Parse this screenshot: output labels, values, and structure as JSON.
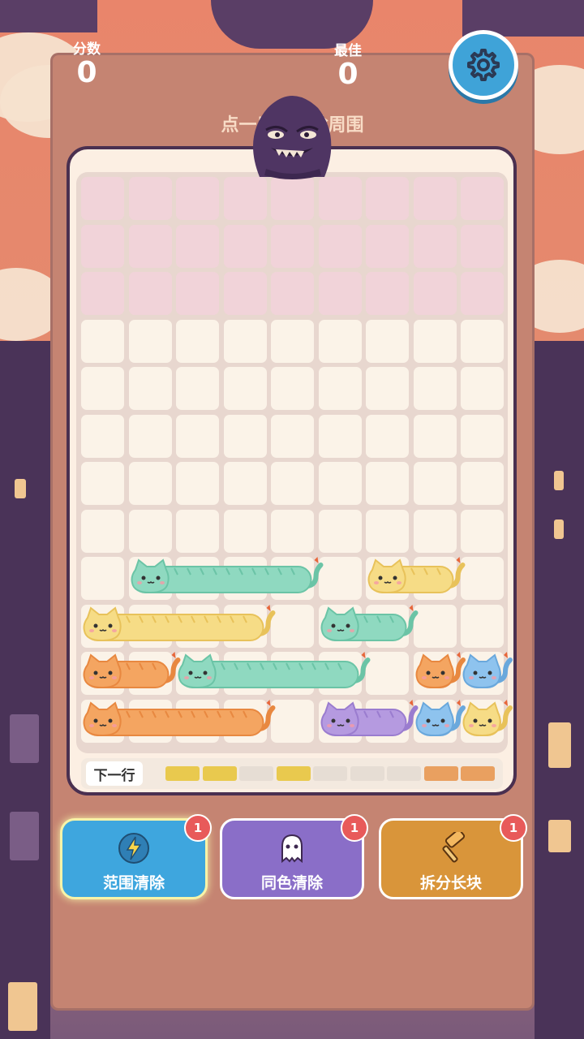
{
  "score": {
    "label": "分数",
    "value": "0"
  },
  "best": {
    "label": "最佳",
    "value": "0"
  },
  "hint": "点一只猫消除周围",
  "settings": {
    "icon": "gear-icon"
  },
  "board": {
    "cols": 9,
    "rows": 12,
    "pink_rows": 3,
    "cats": [
      {
        "row": 8,
        "col": 1,
        "length": 4,
        "color": "mint"
      },
      {
        "row": 8,
        "col": 6,
        "length": 2,
        "color": "yellow"
      },
      {
        "row": 9,
        "col": 0,
        "length": 4,
        "color": "yellow"
      },
      {
        "row": 9,
        "col": 5,
        "length": 2,
        "color": "mint"
      },
      {
        "row": 10,
        "col": 0,
        "length": 2,
        "color": "orange"
      },
      {
        "row": 10,
        "col": 2,
        "length": 4,
        "color": "mint"
      },
      {
        "row": 10,
        "col": 7,
        "length": 1,
        "color": "orange"
      },
      {
        "row": 10,
        "col": 8,
        "length": 1,
        "color": "blue"
      },
      {
        "row": 11,
        "col": 0,
        "length": 4,
        "color": "orange"
      },
      {
        "row": 11,
        "col": 5,
        "length": 2,
        "color": "purple"
      },
      {
        "row": 11,
        "col": 7,
        "length": 1,
        "color": "blue"
      },
      {
        "row": 11,
        "col": 8,
        "length": 1,
        "color": "yellow"
      }
    ]
  },
  "next_row": {
    "label": "下一行",
    "segments": [
      "yellow",
      "yellow",
      "empty",
      "yellow",
      "empty",
      "empty",
      "empty",
      "orange",
      "orange"
    ]
  },
  "tools": [
    {
      "label": "范围清除",
      "badge": "1",
      "icon": "lightning-icon",
      "color": "#3ea6de"
    },
    {
      "label": "同色清除",
      "badge": "1",
      "icon": "ghost-icon",
      "color": "#8a6ec8"
    },
    {
      "label": "拆分长块",
      "badge": "1",
      "icon": "hammer-icon",
      "color": "#d9953a"
    }
  ],
  "colors": {
    "mint": "#8fd9c0",
    "yellow": "#f6dc86",
    "orange": "#f4a561",
    "blue": "#8ec3ee",
    "purple": "#b59ae0"
  }
}
